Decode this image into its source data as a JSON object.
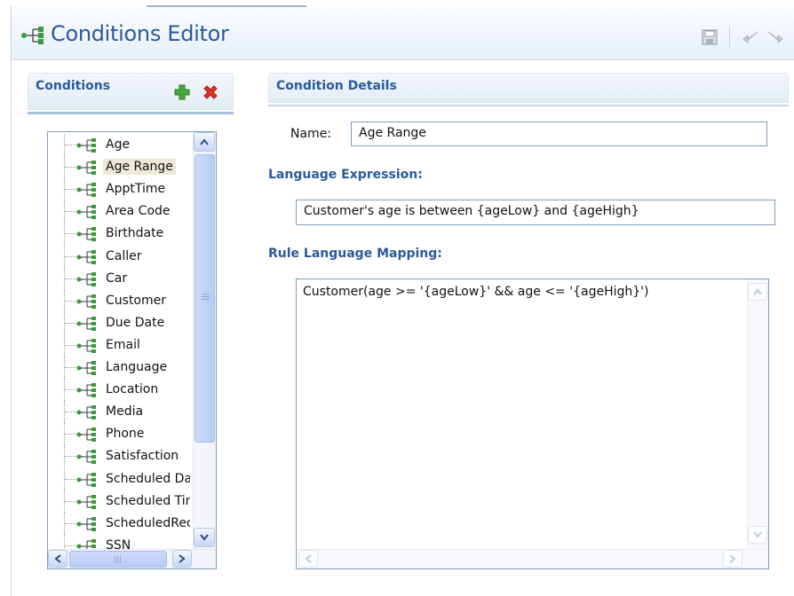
{
  "header": {
    "title": "Conditions Editor",
    "icon": "conditions-tree-icon",
    "toolbar": [
      {
        "name": "save-icon"
      },
      {
        "name": "undo-icon"
      },
      {
        "name": "redo-icon"
      }
    ]
  },
  "conditions_panel": {
    "title": "Conditions",
    "add_icon": "green-plus-icon",
    "delete_icon": "red-x-icon",
    "items": [
      {
        "label": "Age",
        "selected": false
      },
      {
        "label": "Age Range",
        "selected": true
      },
      {
        "label": "ApptTime",
        "selected": false
      },
      {
        "label": "Area Code",
        "selected": false
      },
      {
        "label": "Birthdate",
        "selected": false
      },
      {
        "label": "Caller",
        "selected": false
      },
      {
        "label": "Car",
        "selected": false
      },
      {
        "label": "Customer",
        "selected": false
      },
      {
        "label": "Due Date",
        "selected": false
      },
      {
        "label": "Email",
        "selected": false
      },
      {
        "label": "Language",
        "selected": false
      },
      {
        "label": "Location",
        "selected": false
      },
      {
        "label": "Media",
        "selected": false
      },
      {
        "label": "Phone",
        "selected": false
      },
      {
        "label": "Satisfaction",
        "selected": false
      },
      {
        "label": "Scheduled Da",
        "selected": false
      },
      {
        "label": "Scheduled Tin",
        "selected": false
      },
      {
        "label": "ScheduledRec",
        "selected": false
      },
      {
        "label": "SSN",
        "selected": false
      }
    ]
  },
  "details_panel": {
    "title": "Condition Details",
    "name_label": "Name:",
    "name_value": "Age Range",
    "language_expression_label": "Language Expression:",
    "language_expression_value": "Customer's age is between {ageLow} and {ageHigh}",
    "rule_mapping_label": "Rule Language Mapping:",
    "rule_mapping_value": "Customer(age >= '{ageLow}' && age <= '{ageHigh}')"
  },
  "colors": {
    "accent": "#2a5a9c",
    "header_bg": "#e7eff9",
    "selection": "#ece9d8",
    "border": "#7f9db9"
  }
}
